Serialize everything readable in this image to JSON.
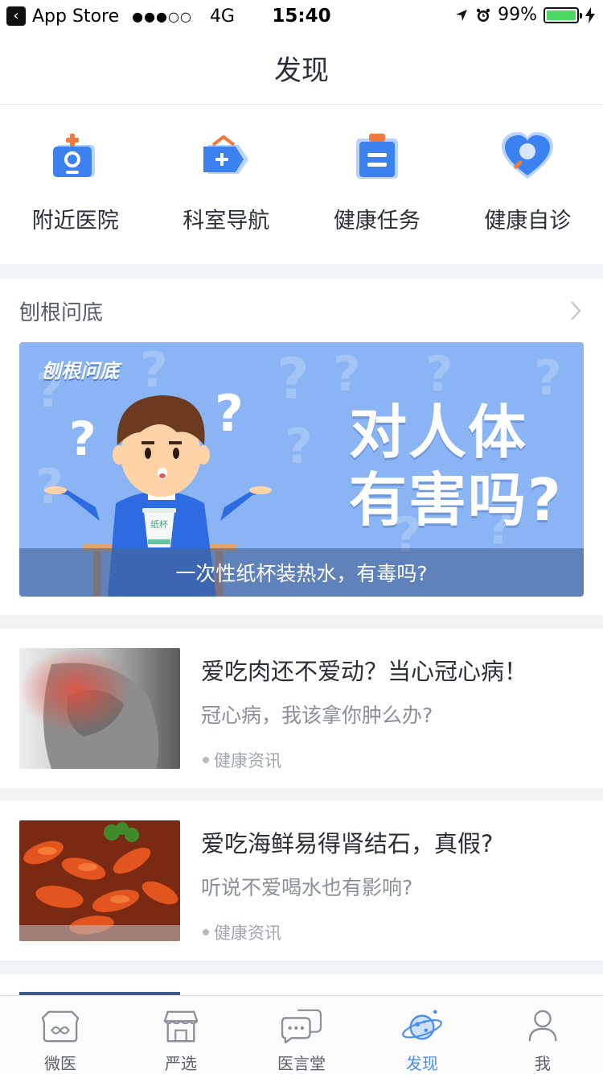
{
  "status_bar": {
    "back_app": "App Store",
    "signal": "●●●○○",
    "carrier": "4G",
    "time": "15:40",
    "battery": "99%",
    "battery_level": 0.99
  },
  "header": {
    "title": "发现"
  },
  "quick_entries": [
    {
      "label": "附近医院",
      "icon": "hospital-icon"
    },
    {
      "label": "科室导航",
      "icon": "department-tag-icon"
    },
    {
      "label": "健康任务",
      "icon": "clipboard-icon"
    },
    {
      "label": "健康自诊",
      "icon": "heart-search-icon"
    }
  ],
  "featured": {
    "section_title": "刨根问底",
    "banner_logo": "刨根问底",
    "banner_headline_line1": "对人体",
    "banner_headline_line2": "有害吗?",
    "banner_cup_label": "纸杯",
    "banner_caption": "一次性纸杯装热水，有毒吗?"
  },
  "articles": [
    {
      "title": "爱吃肉还不爱动？当心冠心病！",
      "subtitle": "冠心病，我该拿你肿么办?",
      "tag": "健康资讯"
    },
    {
      "title": "爱吃海鲜易得肾结石，真假?",
      "subtitle": "听说不爱喝水也有影响?",
      "tag": "健康资讯"
    }
  ],
  "tabbar": {
    "active": "发现",
    "items": [
      {
        "label": "微医",
        "icon": "weiyi-bear-icon"
      },
      {
        "label": "严选",
        "icon": "store-icon"
      },
      {
        "label": "医言堂",
        "icon": "chat-bubbles-icon"
      },
      {
        "label": "发现",
        "icon": "planet-icon"
      },
      {
        "label": "我",
        "icon": "person-icon"
      }
    ]
  },
  "colors": {
    "accent": "#4a8df0",
    "icon_blue": "#3b82f0",
    "icon_orange": "#f07a3e",
    "banner_bg": "#8ab4f4"
  }
}
